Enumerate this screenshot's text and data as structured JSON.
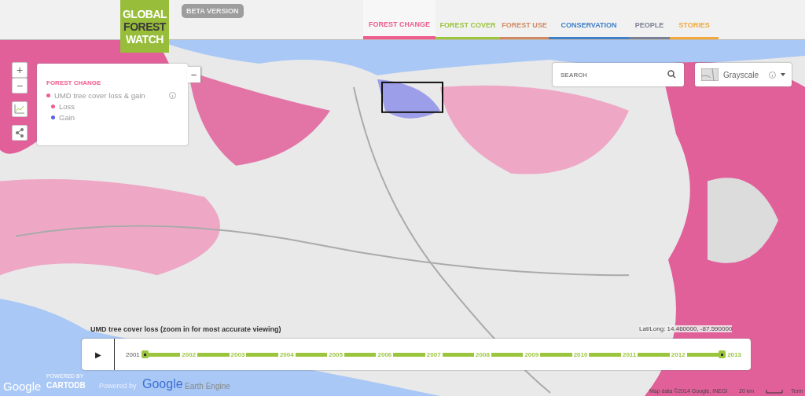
{
  "header": {
    "logo": [
      "GLOBAL",
      "FOREST",
      "WATCH"
    ],
    "badge": "BETA VERSION",
    "tabs": [
      {
        "label": "FOREST CHANGE",
        "selected": true,
        "color": "#ef5d8f"
      },
      {
        "label": "FOREST COVER",
        "selected": false,
        "color": "#9bc53d"
      },
      {
        "label": "FOREST USE",
        "selected": false,
        "color": "#d08a63"
      },
      {
        "label": "CONSERVATION",
        "selected": false,
        "color": "#3f7fc8"
      },
      {
        "label": "PEOPLE",
        "selected": false,
        "color": "#7a8096"
      },
      {
        "label": "STORIES",
        "selected": false,
        "color": "#f2a93b"
      }
    ]
  },
  "zoom": {
    "in": "+",
    "out": "−"
  },
  "legend": {
    "title": "FOREST CHANGE",
    "collapse": "−",
    "layer": {
      "name": "UMD tree cover loss & gain",
      "color": "#ef5d8f"
    },
    "items": [
      {
        "label": "Loss",
        "color": "#ef5d8f"
      },
      {
        "label": "Gain",
        "color": "#5a5ee8"
      }
    ]
  },
  "search": {
    "placeholder": "SEARCH"
  },
  "basemap": {
    "label": "Grayscale"
  },
  "map": {
    "kind": "picture",
    "caption": "UMD tree cover loss (zoom in for most accurate viewing)",
    "coords": "Lat/Long: 14.460000, -87.590000",
    "attribution": "Map data ©2014 Google, INEGI",
    "scale": "20 km",
    "terms": "Term"
  },
  "timeline": {
    "play": "▶",
    "years": [
      "2001",
      "2002",
      "2003",
      "2004",
      "2005",
      "2006",
      "2007",
      "2008",
      "2009",
      "2010",
      "2011",
      "2012",
      "2013"
    ]
  },
  "footer": {
    "google": "Google",
    "cartodb_small": "POWERED BY",
    "cartodb": "CARTODB",
    "powered": "Powered by",
    "google2": "Google",
    "engine": "Earth Engine"
  }
}
